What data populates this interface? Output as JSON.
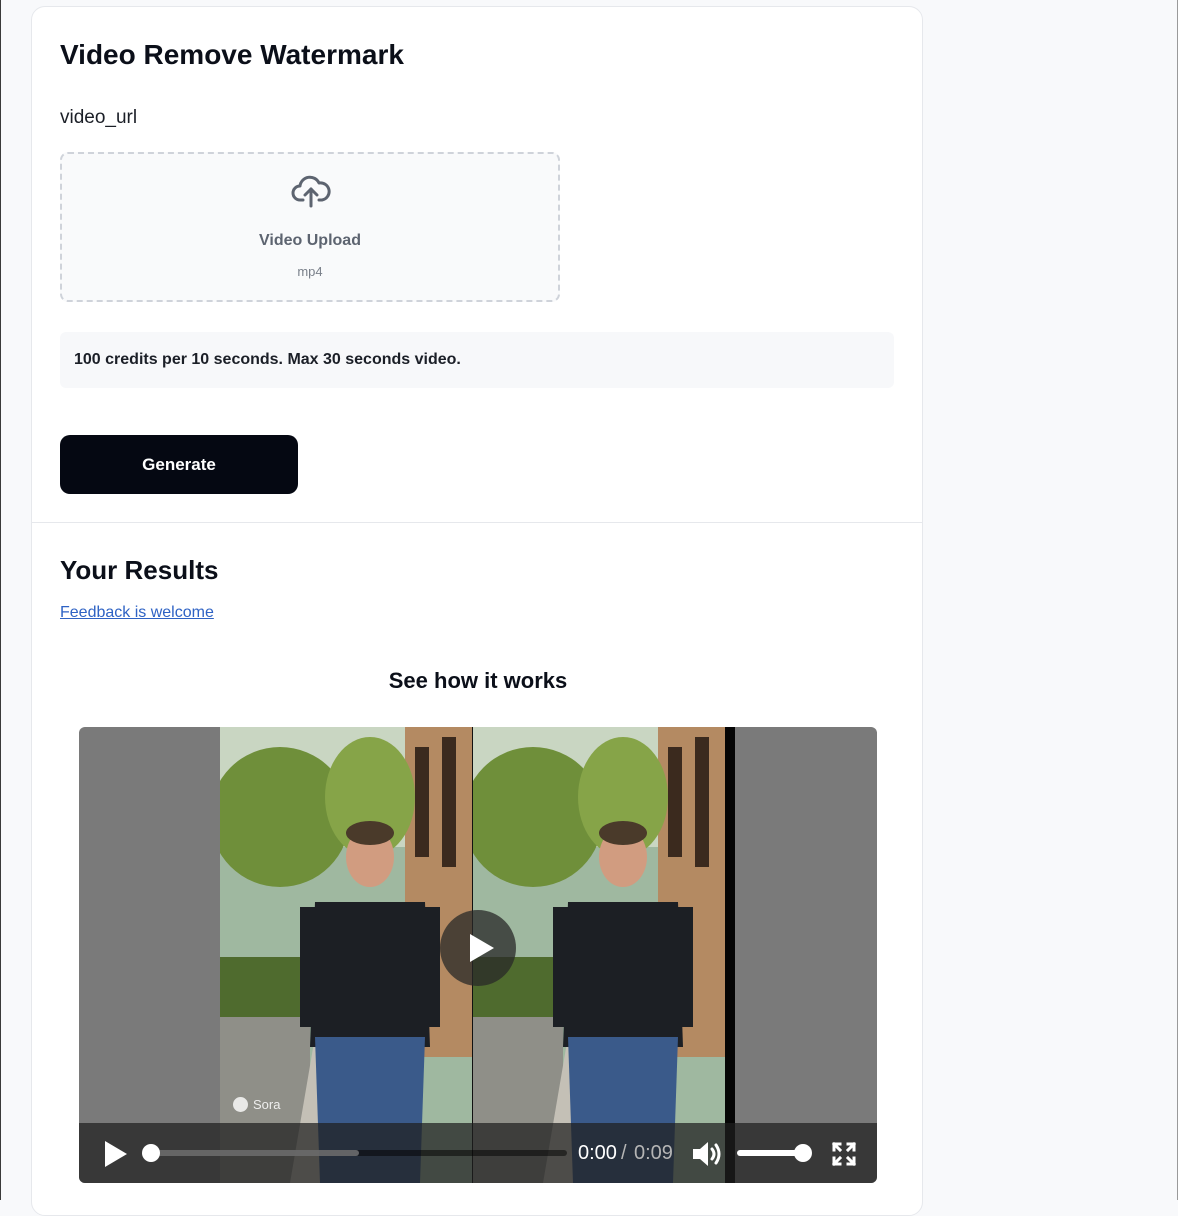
{
  "form": {
    "title": "Video Remove Watermark",
    "field_label": "video_url",
    "upload": {
      "icon": "cloud-upload-icon",
      "label": "Video Upload",
      "format": "mp4"
    },
    "info": "100 credits per 10 seconds. Max 30 seconds video.",
    "generate_label": "Generate"
  },
  "results": {
    "title": "Your Results",
    "feedback_link": "Feedback is welcome",
    "demo_title": "See how it works"
  },
  "video": {
    "watermark_text": "Sora",
    "current_time": "0:00",
    "separator": "/",
    "total_time": "0:09",
    "progress_fraction": 0.0,
    "buffered_fraction": 0.5,
    "volume_fraction": 1.0,
    "icons": [
      "play-icon",
      "volume-icon",
      "fullscreen-icon"
    ]
  },
  "colors": {
    "primary_button": "#050812",
    "link": "#2e62c4",
    "page_background": "#f8f9fb"
  }
}
